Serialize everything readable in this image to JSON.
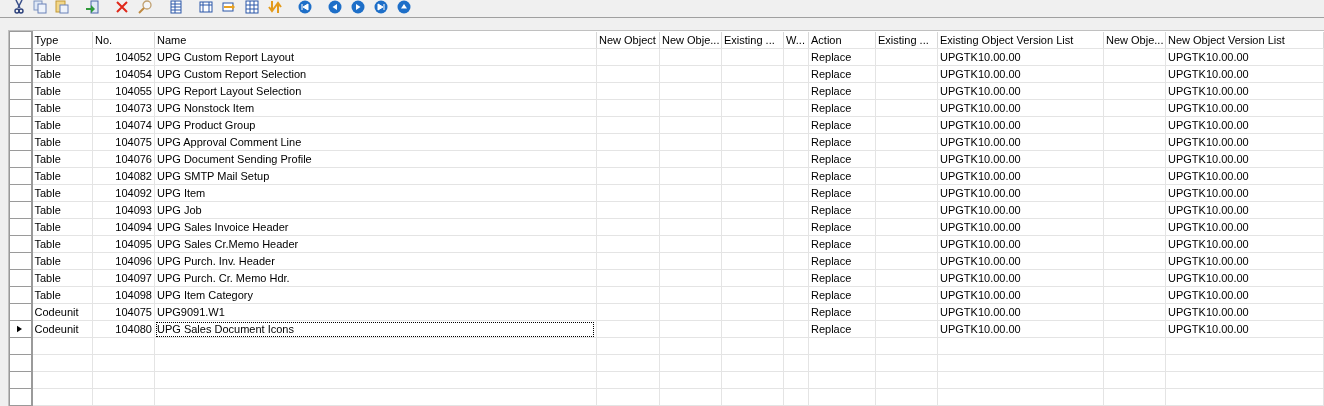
{
  "table": {
    "columns": [
      {
        "label": "Type"
      },
      {
        "label": "No."
      },
      {
        "label": "Name"
      },
      {
        "label": "New Object"
      },
      {
        "label": "New Obje..."
      },
      {
        "label": "Existing ..."
      },
      {
        "label": "W..."
      },
      {
        "label": "Action"
      },
      {
        "label": "Existing ..."
      },
      {
        "label": "Existing Object Version List"
      },
      {
        "label": "New Obje..."
      },
      {
        "label": "New Object Version List"
      }
    ],
    "rows": [
      {
        "selected": false,
        "cells": [
          "Table",
          "104052",
          "UPG Custom Report Layout",
          "",
          "",
          "",
          "",
          "Replace",
          "",
          "UPGTK10.00.00",
          "",
          "UPGTK10.00.00"
        ]
      },
      {
        "selected": false,
        "cells": [
          "Table",
          "104054",
          "UPG Custom Report Selection",
          "",
          "",
          "",
          "",
          "Replace",
          "",
          "UPGTK10.00.00",
          "",
          "UPGTK10.00.00"
        ]
      },
      {
        "selected": false,
        "cells": [
          "Table",
          "104055",
          "UPG Report Layout Selection",
          "",
          "",
          "",
          "",
          "Replace",
          "",
          "UPGTK10.00.00",
          "",
          "UPGTK10.00.00"
        ]
      },
      {
        "selected": false,
        "cells": [
          "Table",
          "104073",
          "UPG Nonstock Item",
          "",
          "",
          "",
          "",
          "Replace",
          "",
          "UPGTK10.00.00",
          "",
          "UPGTK10.00.00"
        ]
      },
      {
        "selected": false,
        "cells": [
          "Table",
          "104074",
          "UPG Product Group",
          "",
          "",
          "",
          "",
          "Replace",
          "",
          "UPGTK10.00.00",
          "",
          "UPGTK10.00.00"
        ]
      },
      {
        "selected": false,
        "cells": [
          "Table",
          "104075",
          "UPG Approval Comment Line",
          "",
          "",
          "",
          "",
          "Replace",
          "",
          "UPGTK10.00.00",
          "",
          "UPGTK10.00.00"
        ]
      },
      {
        "selected": false,
        "cells": [
          "Table",
          "104076",
          "UPG Document Sending Profile",
          "",
          "",
          "",
          "",
          "Replace",
          "",
          "UPGTK10.00.00",
          "",
          "UPGTK10.00.00"
        ]
      },
      {
        "selected": false,
        "cells": [
          "Table",
          "104082",
          "UPG SMTP Mail Setup",
          "",
          "",
          "",
          "",
          "Replace",
          "",
          "UPGTK10.00.00",
          "",
          "UPGTK10.00.00"
        ]
      },
      {
        "selected": false,
        "cells": [
          "Table",
          "104092",
          "UPG Item",
          "",
          "",
          "",
          "",
          "Replace",
          "",
          "UPGTK10.00.00",
          "",
          "UPGTK10.00.00"
        ]
      },
      {
        "selected": false,
        "cells": [
          "Table",
          "104093",
          "UPG Job",
          "",
          "",
          "",
          "",
          "Replace",
          "",
          "UPGTK10.00.00",
          "",
          "UPGTK10.00.00"
        ]
      },
      {
        "selected": false,
        "cells": [
          "Table",
          "104094",
          "UPG Sales Invoice Header",
          "",
          "",
          "",
          "",
          "Replace",
          "",
          "UPGTK10.00.00",
          "",
          "UPGTK10.00.00"
        ]
      },
      {
        "selected": false,
        "cells": [
          "Table",
          "104095",
          "UPG Sales Cr.Memo Header",
          "",
          "",
          "",
          "",
          "Replace",
          "",
          "UPGTK10.00.00",
          "",
          "UPGTK10.00.00"
        ]
      },
      {
        "selected": false,
        "cells": [
          "Table",
          "104096",
          "UPG Purch. Inv. Header",
          "",
          "",
          "",
          "",
          "Replace",
          "",
          "UPGTK10.00.00",
          "",
          "UPGTK10.00.00"
        ]
      },
      {
        "selected": false,
        "cells": [
          "Table",
          "104097",
          "UPG Purch. Cr. Memo Hdr.",
          "",
          "",
          "",
          "",
          "Replace",
          "",
          "UPGTK10.00.00",
          "",
          "UPGTK10.00.00"
        ]
      },
      {
        "selected": false,
        "cells": [
          "Table",
          "104098",
          "UPG Item Category",
          "",
          "",
          "",
          "",
          "Replace",
          "",
          "UPGTK10.00.00",
          "",
          "UPGTK10.00.00"
        ]
      },
      {
        "selected": false,
        "cells": [
          "Codeunit",
          "104075",
          "UPG9091.W1",
          "",
          "",
          "",
          "",
          "Replace",
          "",
          "UPGTK10.00.00",
          "",
          "UPGTK10.00.00"
        ]
      },
      {
        "selected": true,
        "cells": [
          "Codeunit",
          "104080",
          "UPG Sales Document Icons",
          "",
          "",
          "",
          "",
          "Replace",
          "",
          "UPGTK10.00.00",
          "",
          "UPGTK10.00.00"
        ]
      }
    ]
  }
}
